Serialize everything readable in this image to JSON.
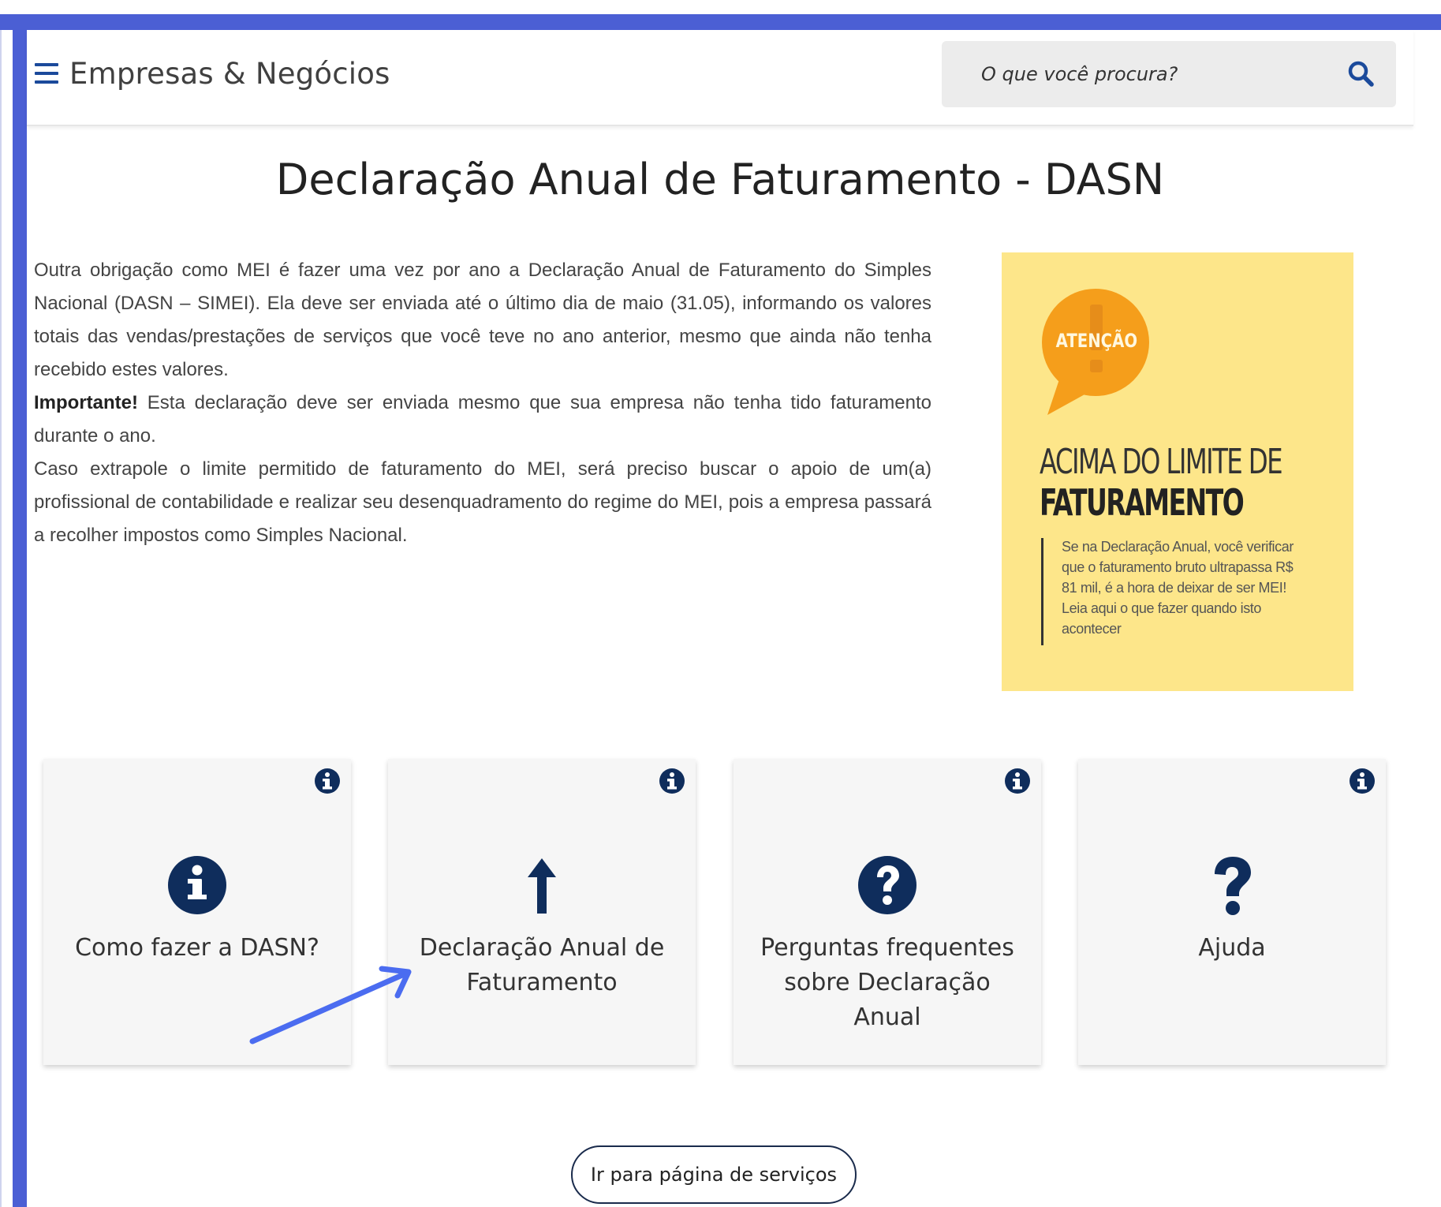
{
  "colors": {
    "frame_accent": "#4b5fd4",
    "icon_navy": "#0f2d5c",
    "header_link_blue": "#1b4a9b",
    "banner_bg": "#fde68a",
    "bubble_orange": "#f59e1b",
    "card_bg": "#f6f6f6"
  },
  "header": {
    "brand": "Empresas & Negócios",
    "menu_icon": "hamburger-menu-icon",
    "search": {
      "placeholder": "O que você procura?",
      "icon": "search-icon"
    }
  },
  "page": {
    "title": "Declaração Anual de Faturamento - DASN"
  },
  "content": {
    "paragraph_1": "Outra obrigação como MEI é fazer uma vez por ano a Declaração Anual de Faturamento do Simples Nacional (DASN – SIMEI).  Ela deve ser enviada até o último dia de maio (31.05), informando os valores totais das vendas/prestações de serviços que você teve no ano anterior, mesmo que ainda não tenha recebido estes valores.",
    "important_label": "Importante!",
    "paragraph_2": " Esta declaração deve ser enviada mesmo que sua empresa não tenha tido faturamento durante o ano.",
    "paragraph_3": "Caso extrapole o limite permitido de faturamento do MEI, será preciso buscar o apoio de um(a) profissional de contabilidade e realizar seu desenquadramento do regime do MEI, pois a empresa passará a recolher impostos como Simples Nacional."
  },
  "banner": {
    "badge": "ATENÇÃO",
    "title_line_1": "ACIMA DO LIMITE DE",
    "title_line_2": "FATURAMENTO",
    "text": "Se na Declaração Anual, você verificar que o faturamento bruto ultrapassa R$ 81 mil, é a hora de deixar de ser MEI! Leia aqui o que fazer quando isto acontecer"
  },
  "cards": [
    {
      "label": "Como fazer a DASN?",
      "icon": "info-circle-icon"
    },
    {
      "label": "Declaração Anual de Faturamento",
      "icon": "arrow-up-icon"
    },
    {
      "label": "Perguntas frequentes sobre Declaração Anual",
      "icon": "question-circle-icon"
    },
    {
      "label": "Ajuda",
      "icon": "question-mark-icon"
    }
  ],
  "footer": {
    "services_button": "Ir para página de serviços"
  }
}
